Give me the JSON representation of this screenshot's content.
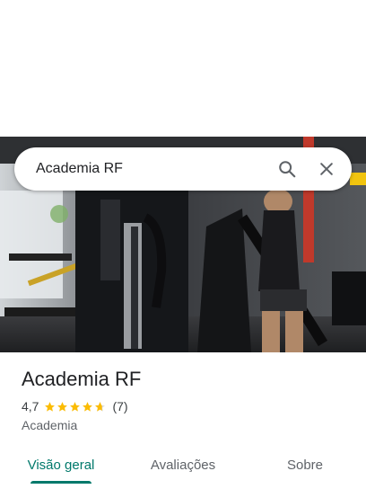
{
  "search": {
    "query": "Academia RF"
  },
  "place": {
    "name": "Academia RF",
    "rating": "4,7",
    "rating_value": 4.7,
    "review_count": "(7)",
    "category": "Academia"
  },
  "tabs": [
    {
      "label": "Visão geral",
      "active": true
    },
    {
      "label": "Avaliações",
      "active": false
    },
    {
      "label": "Sobre",
      "active": false
    }
  ],
  "icons": {
    "search": "search-icon",
    "close": "close-icon",
    "star": "star-icon"
  },
  "colors": {
    "accent": "#00796b",
    "star": "#fbbc04"
  }
}
